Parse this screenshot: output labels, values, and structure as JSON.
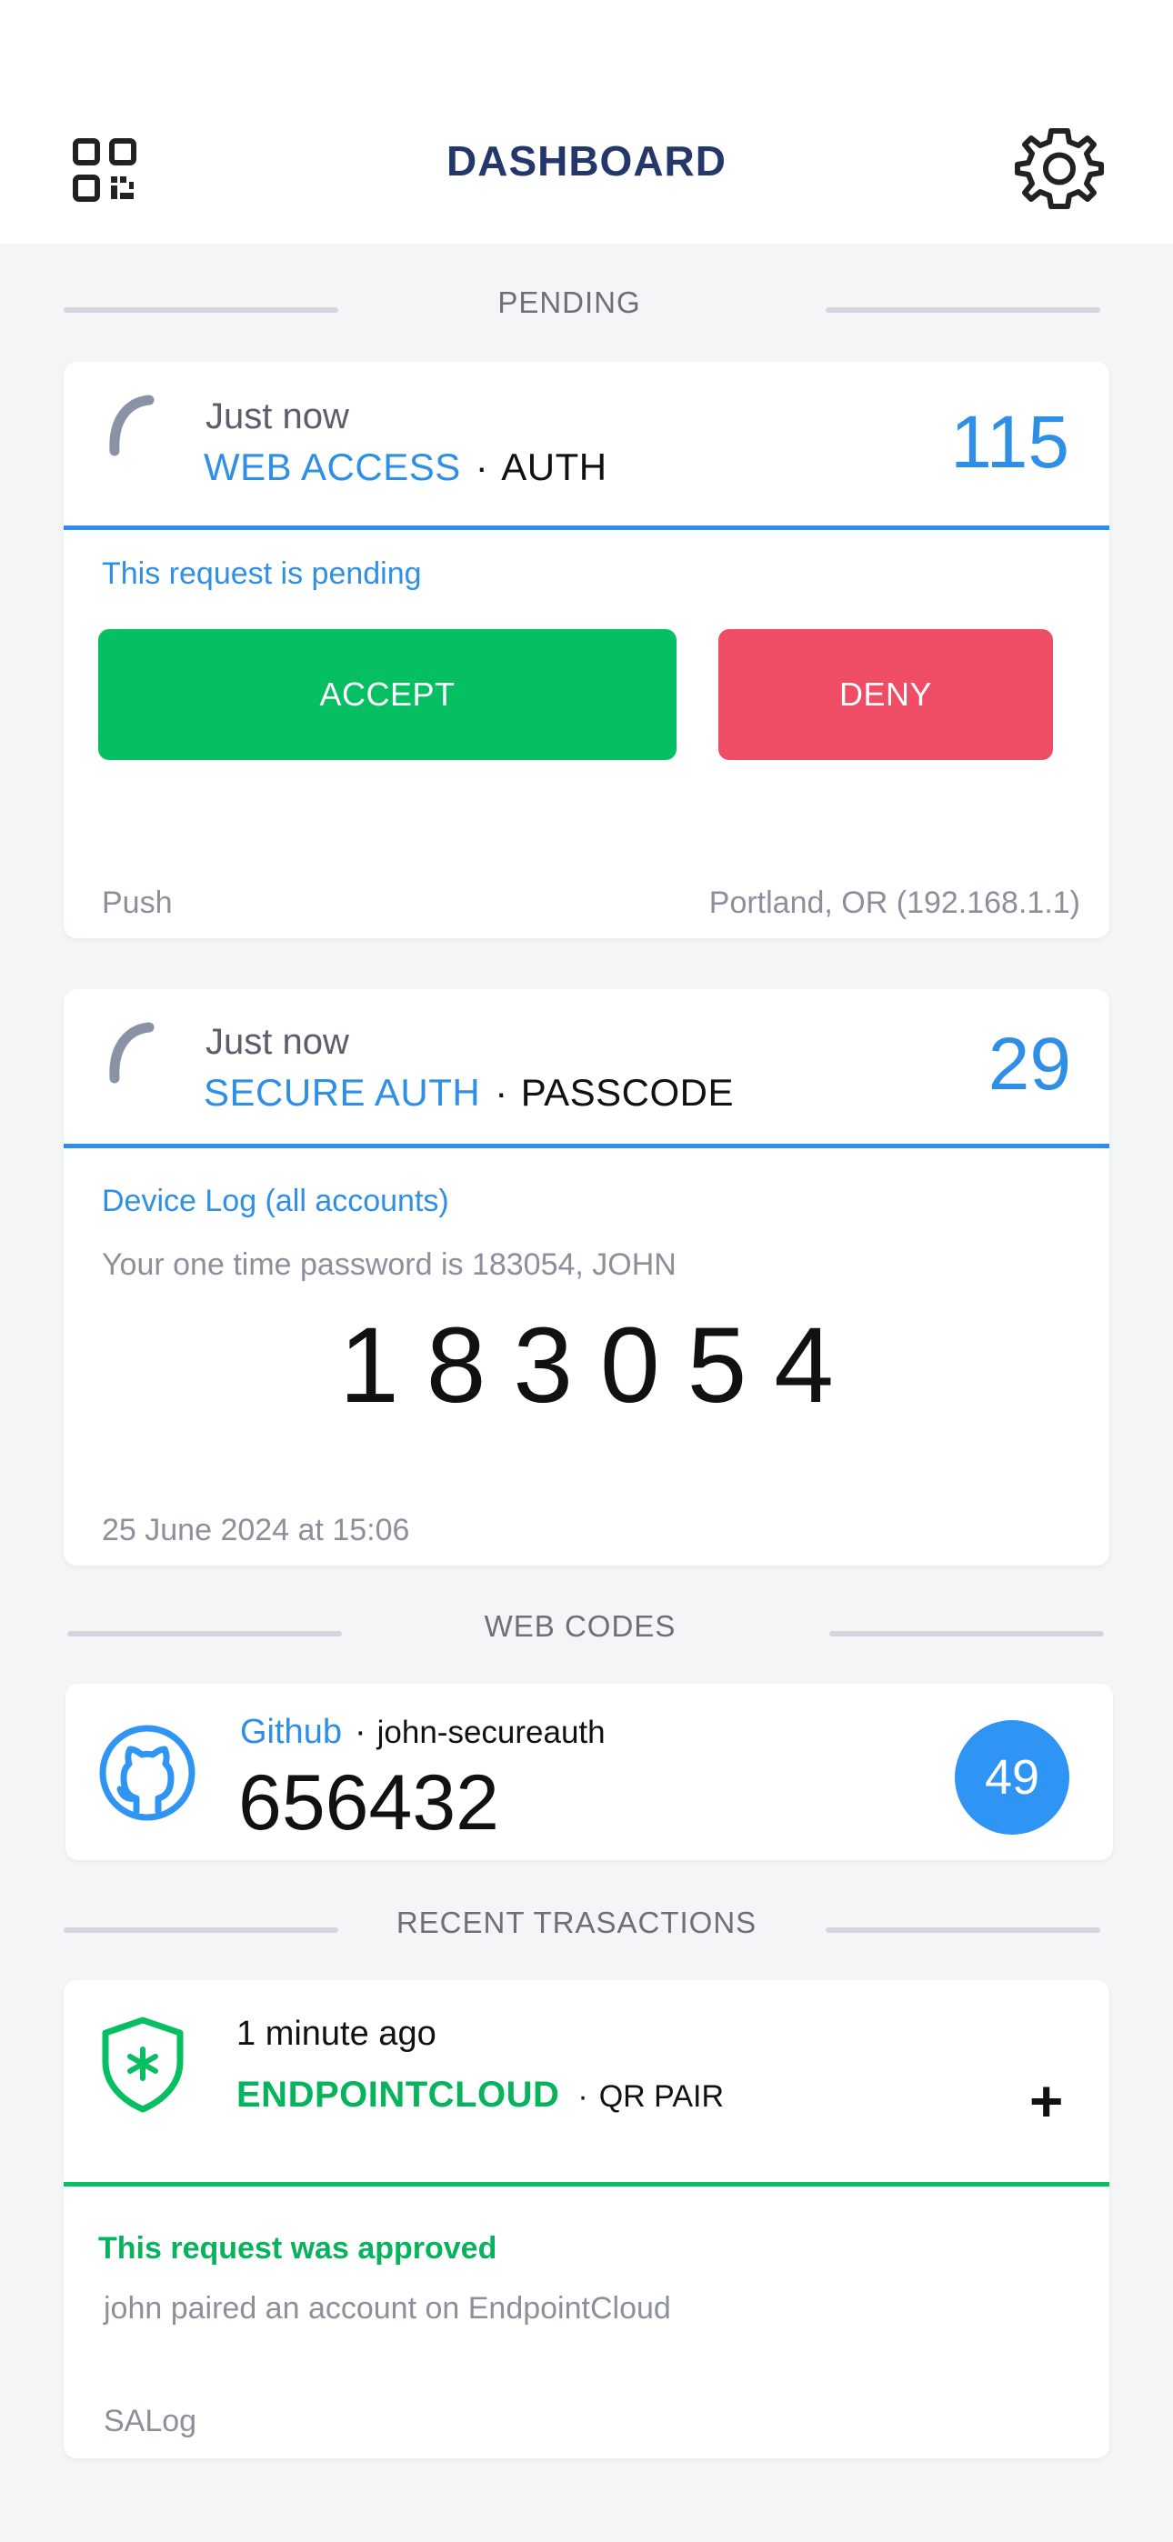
{
  "header": {
    "title": "DASHBOARD",
    "qr_icon": "qr-code-icon",
    "settings_icon": "gear-icon"
  },
  "sections": {
    "pending": "PENDING",
    "web_codes": "WEB CODES",
    "recent": "RECENT TRASACTIONS"
  },
  "pending_card": {
    "timestamp": "Just now",
    "account": "WEB ACCESS",
    "type": "AUTH",
    "counter": "115",
    "status": "This request is pending",
    "accept_label": "ACCEPT",
    "deny_label": "DENY",
    "method": "Push",
    "location": "Portland, OR (192.168.1.1)"
  },
  "passcode_card": {
    "timestamp": "Just now",
    "account": "SECURE AUTH",
    "type": "PASSCODE",
    "counter": "29",
    "log_title": "Device Log (all accounts)",
    "message": "Your one time password is 183054, JOHN",
    "code": "183054",
    "date": "25 June 2024 at 15:06"
  },
  "web_code": {
    "service": "Github",
    "user": "john-secureauth",
    "code": "656432",
    "seconds_left": "49"
  },
  "transaction": {
    "timestamp": "1 minute ago",
    "account": "ENDPOINTCLOUD",
    "type": "QR PAIR",
    "status": "This request was approved",
    "message": "john paired an account on EndpointCloud",
    "source": "SALog"
  },
  "colors": {
    "accent_blue": "#2f8fe6",
    "accept_green": "#07bf63",
    "deny_red": "#ef4c66",
    "title_navy": "#24376b"
  }
}
